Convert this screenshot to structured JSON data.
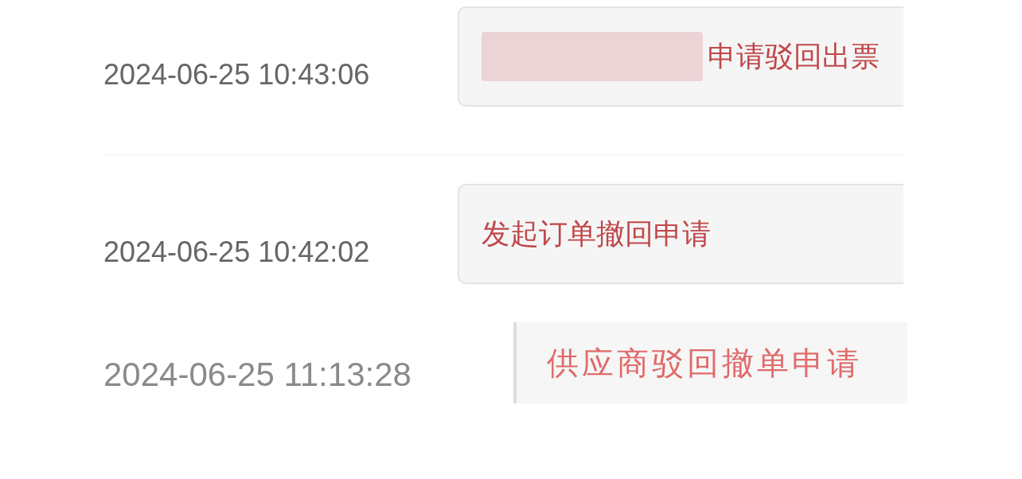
{
  "log_entries": [
    {
      "kind": "rounded",
      "time": "2024-06-25 10:43:06",
      "redacted": true,
      "message": "申请驳回出票"
    },
    {
      "kind": "rounded",
      "time": "2024-06-25 10:42:02",
      "redacted": false,
      "message": "发起订单撤回申请"
    },
    {
      "kind": "flat",
      "time": "2024-06-25 11:13:28",
      "redacted": false,
      "message": "供应商驳回撤单申请"
    }
  ]
}
